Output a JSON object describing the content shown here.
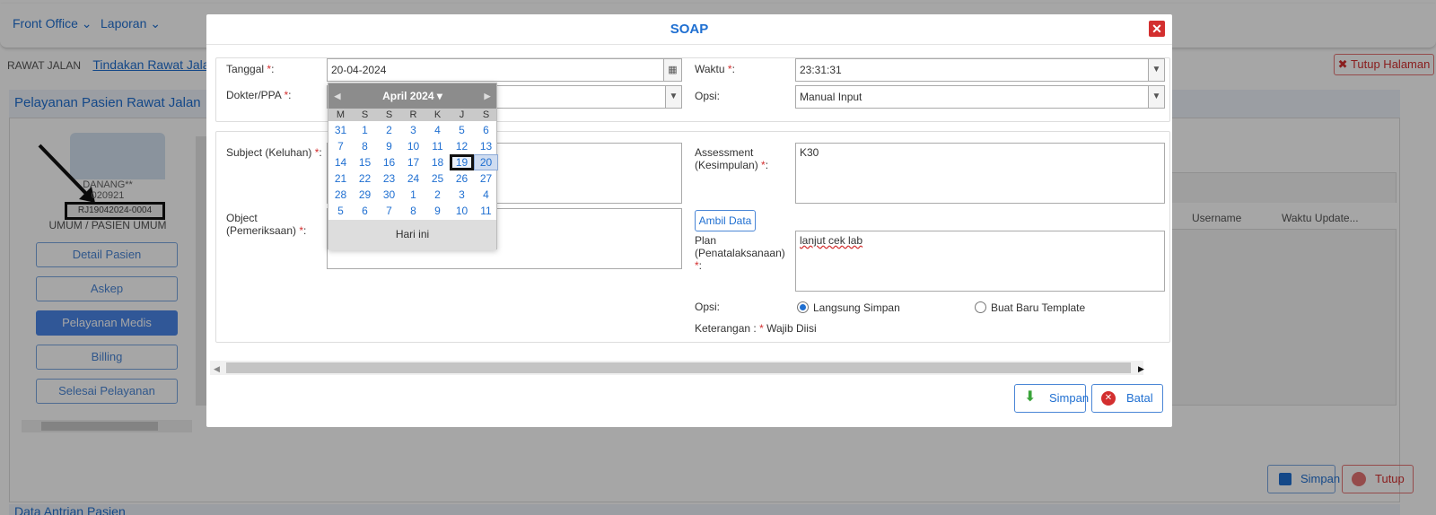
{
  "nav": {
    "front_office": "Front Office",
    "laporan": "Laporan"
  },
  "breadcrumb": {
    "root": "RAWAT JALAN",
    "current": "Tindakan Rawat Jalan"
  },
  "tutup_halaman": "Tutup Halaman",
  "panel_title": "Pelayanan Pasien Rawat Jalan",
  "patient": {
    "name": "DANANG**",
    "rm": "020921",
    "reg_no": "RJ19042024-0004",
    "status": "UMUM / PASIEN UMUM"
  },
  "side_buttons": [
    "Detail Pasien",
    "Askep",
    "Pelayanan Medis",
    "Billing",
    "Selesai Pelayanan"
  ],
  "right_table": {
    "col_username": "Username",
    "col_waktu": "Waktu Update..."
  },
  "bottom_buttons": {
    "simpan": "Simpan",
    "tutup": "Tutup"
  },
  "bottom_tab": "Data Antrian Pasien",
  "modal": {
    "title": "SOAP",
    "tanggal_label": "Tanggal",
    "tanggal_value": "20-04-2024",
    "dokter_label": "Dokter/PPA",
    "waktu_label": "Waktu",
    "waktu_value": "23:31:31",
    "opsi_label": "Opsi:",
    "opsi_value": "Manual Input",
    "subject_label": "Subject (Keluhan)",
    "object_label": "Object",
    "object_label2": "(Pemeriksaan)",
    "assessment_label": "Assessment",
    "assessment_label2": "(Kesimpulan)",
    "assessment_value": "K30",
    "ambil_data": "Ambil Data",
    "plan_label": "Plan",
    "plan_label2": "(Penatalaksanaan)",
    "plan_value": "lanjut cek lab",
    "opsi2_label": "Opsi:",
    "radio_langsung": "Langsung Simpan",
    "radio_template": "Buat Baru Template",
    "keterangan": "Keterangan :",
    "wajib": "Wajib Diisi",
    "simpan": "Simpan",
    "batal": "Batal"
  },
  "calendar": {
    "month_label": "April 2024",
    "dow": [
      "M",
      "S",
      "S",
      "R",
      "K",
      "J",
      "S"
    ],
    "weeks": [
      [
        "31",
        "1",
        "2",
        "3",
        "4",
        "5",
        "6"
      ],
      [
        "7",
        "8",
        "9",
        "10",
        "11",
        "12",
        "13"
      ],
      [
        "14",
        "15",
        "16",
        "17",
        "18",
        "19",
        "20"
      ],
      [
        "21",
        "22",
        "23",
        "24",
        "25",
        "26",
        "27"
      ],
      [
        "28",
        "29",
        "30",
        "1",
        "2",
        "3",
        "4"
      ],
      [
        "5",
        "6",
        "7",
        "8",
        "9",
        "10",
        "11"
      ]
    ],
    "today": "Hari ini"
  },
  "colors": {
    "accent": "#1f6fd1",
    "danger": "#d32f2f",
    "active_btn": "#4a86e8"
  }
}
